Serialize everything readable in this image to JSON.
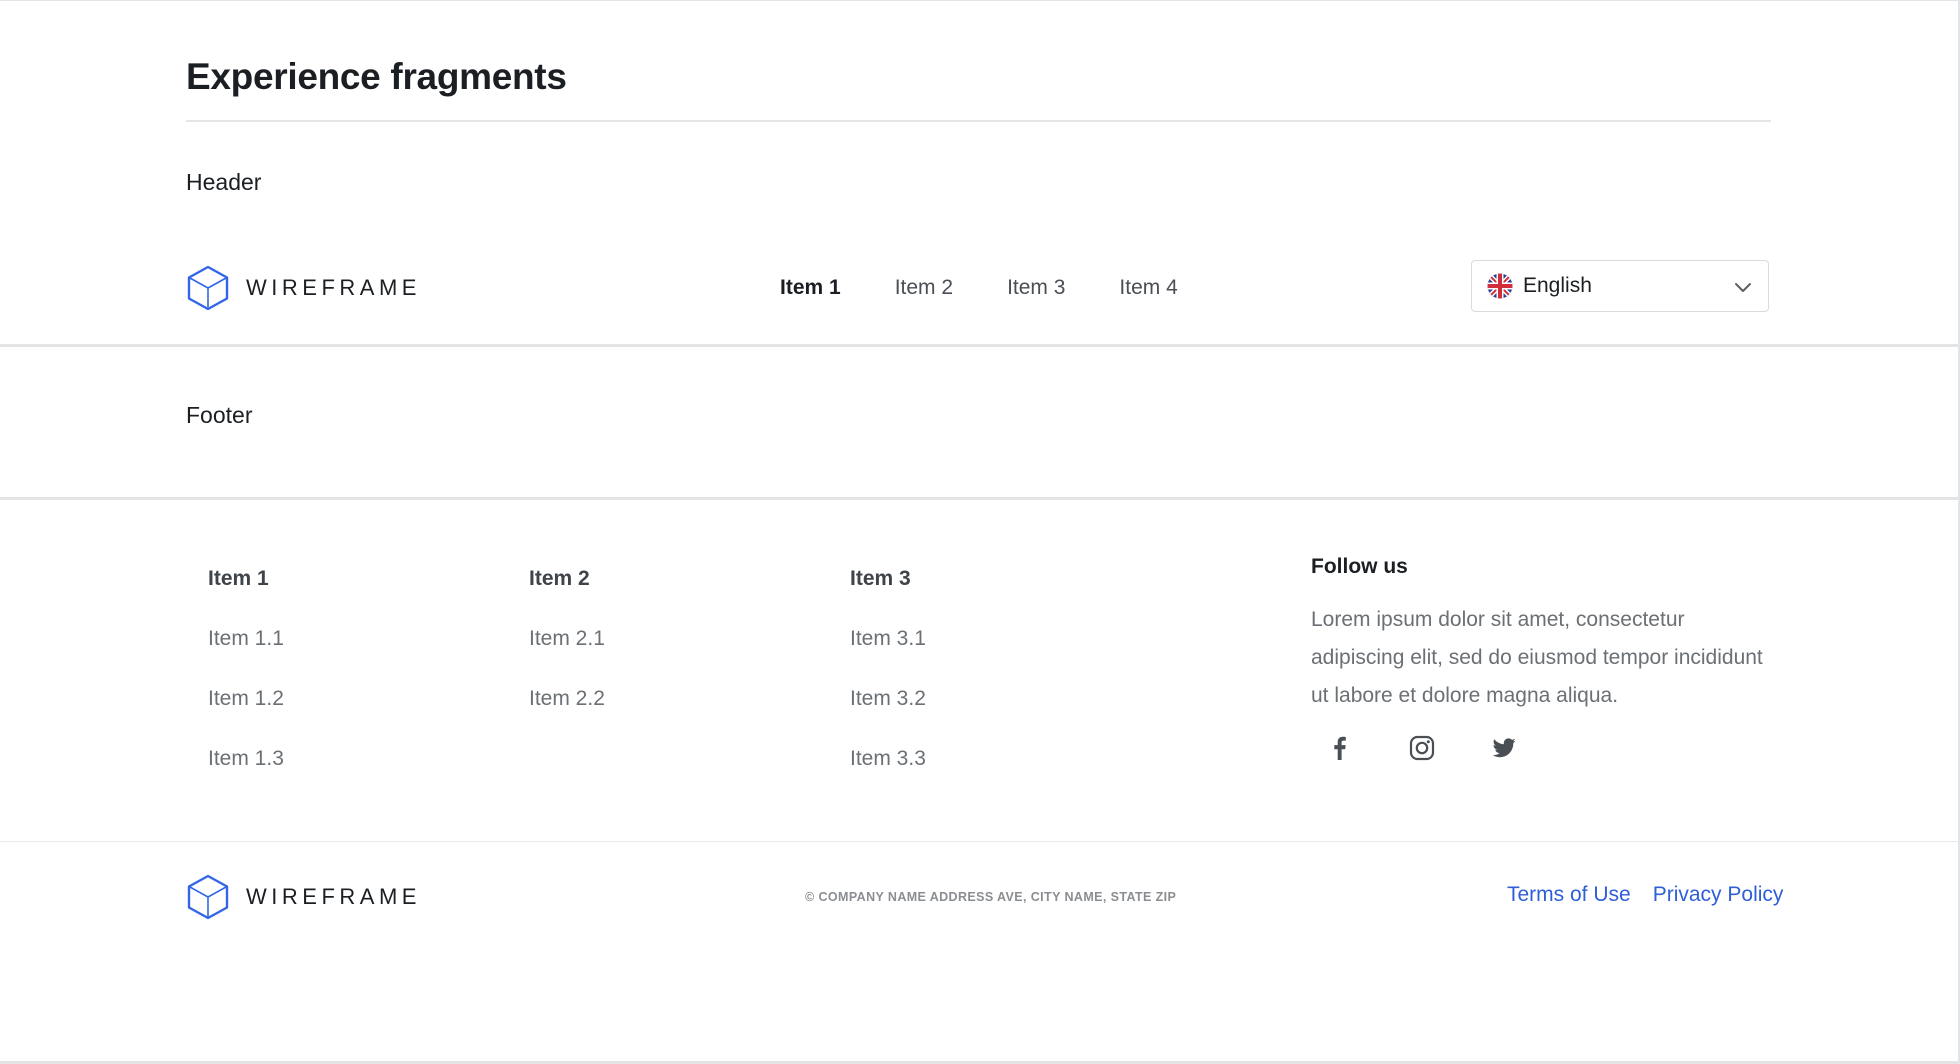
{
  "page": {
    "title": "Experience fragments"
  },
  "sections": {
    "header_label": "Header",
    "footer_label": "Footer"
  },
  "colors": {
    "brand_blue": "#3366e6",
    "link_blue": "#2f5fd6",
    "text_primary": "#1b1f23",
    "text_muted": "#6b7075"
  },
  "header": {
    "logo_icon": "cube-logo-icon",
    "logo_text": "WIREFRAME",
    "nav": [
      {
        "label": "Item 1",
        "active": true
      },
      {
        "label": "Item 2",
        "active": false
      },
      {
        "label": "Item 3",
        "active": false
      },
      {
        "label": "Item 4",
        "active": false
      }
    ],
    "language": {
      "flag_icon": "uk-flag-icon",
      "selected": "English",
      "dropdown_icon": "chevron-down-icon"
    }
  },
  "footer": {
    "columns": [
      {
        "heading": "Item 1",
        "links": [
          "Item 1.1",
          "Item 1.2",
          "Item 1.3"
        ]
      },
      {
        "heading": "Item 2",
        "links": [
          "Item 2.1",
          "Item 2.2"
        ]
      },
      {
        "heading": "Item 3",
        "links": [
          "Item 3.1",
          "Item 3.2",
          "Item 3.3"
        ]
      }
    ],
    "follow": {
      "title": "Follow us",
      "text": "Lorem ipsum dolor sit amet, consectetur adipiscing elit, sed do eiusmod tempor incididunt ut labore et dolore magna aliqua.",
      "social_icons": [
        "facebook-icon",
        "instagram-icon",
        "twitter-icon"
      ]
    },
    "bottom": {
      "logo_text": "WIREFRAME",
      "copyright": "© COMPANY NAME ADDRESS AVE, CITY NAME, STATE ZIP",
      "links": [
        "Terms of Use",
        "Privacy Policy"
      ]
    }
  }
}
